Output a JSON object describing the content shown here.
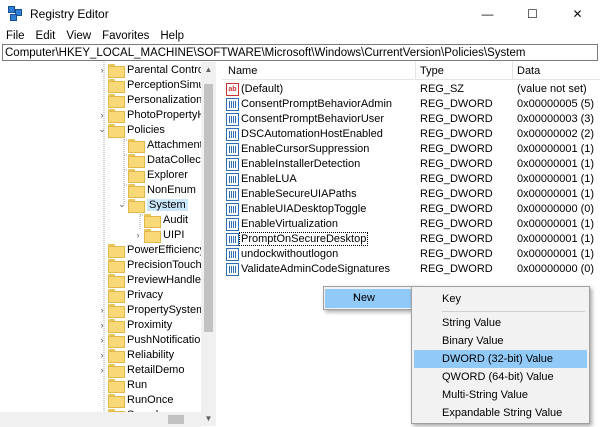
{
  "window": {
    "title": "Registry Editor",
    "minimize": "—",
    "maximize": "☐",
    "close": "✕"
  },
  "menu": [
    "File",
    "Edit",
    "View",
    "Favorites",
    "Help"
  ],
  "address": "Computer\\HKEY_LOCAL_MACHINE\\SOFTWARE\\Microsoft\\Windows\\CurrentVersion\\Policies\\System",
  "tree": [
    {
      "label": "Parental Control",
      "level": 0,
      "arrow": "›"
    },
    {
      "label": "PerceptionSimu",
      "level": 0,
      "arrow": ""
    },
    {
      "label": "Personalization",
      "level": 0,
      "arrow": ""
    },
    {
      "label": "PhotoPropertyH",
      "level": 0,
      "arrow": "›"
    },
    {
      "label": "Policies",
      "level": 0,
      "arrow": "⌄"
    },
    {
      "label": "Attachments",
      "level": 1,
      "arrow": ""
    },
    {
      "label": "DataCollectio",
      "level": 1,
      "arrow": ""
    },
    {
      "label": "Explorer",
      "level": 1,
      "arrow": ""
    },
    {
      "label": "NonEnum",
      "level": 1,
      "arrow": ""
    },
    {
      "label": "System",
      "level": 1,
      "arrow": "⌄",
      "selected": true
    },
    {
      "label": "Audit",
      "level": 2,
      "arrow": ""
    },
    {
      "label": "UIPI",
      "level": 2,
      "arrow": "›"
    },
    {
      "label": "PowerEfficiency",
      "level": 0,
      "arrow": ""
    },
    {
      "label": "PrecisionTouchP",
      "level": 0,
      "arrow": ""
    },
    {
      "label": "PreviewHandlers",
      "level": 0,
      "arrow": ""
    },
    {
      "label": "Privacy",
      "level": 0,
      "arrow": ""
    },
    {
      "label": "PropertySystem",
      "level": 0,
      "arrow": "›"
    },
    {
      "label": "Proximity",
      "level": 0,
      "arrow": "›"
    },
    {
      "label": "PushNotification",
      "level": 0,
      "arrow": "›"
    },
    {
      "label": "Reliability",
      "level": 0,
      "arrow": "›"
    },
    {
      "label": "RetailDemo",
      "level": 0,
      "arrow": "›"
    },
    {
      "label": "Run",
      "level": 0,
      "arrow": ""
    },
    {
      "label": "RunOnce",
      "level": 0,
      "arrow": ""
    },
    {
      "label": "Search",
      "level": 0,
      "arrow": "›"
    }
  ],
  "columns": {
    "name": "Name",
    "type": "Type",
    "data": "Data"
  },
  "values": [
    {
      "name": "(Default)",
      "type": "REG_SZ",
      "data": "(value not set)",
      "icon": "ab"
    },
    {
      "name": "ConsentPromptBehaviorAdmin",
      "type": "REG_DWORD",
      "data": "0x00000005 (5)",
      "icon": "dword"
    },
    {
      "name": "ConsentPromptBehaviorUser",
      "type": "REG_DWORD",
      "data": "0x00000003 (3)",
      "icon": "dword"
    },
    {
      "name": "DSCAutomationHostEnabled",
      "type": "REG_DWORD",
      "data": "0x00000002 (2)",
      "icon": "dword"
    },
    {
      "name": "EnableCursorSuppression",
      "type": "REG_DWORD",
      "data": "0x00000001 (1)",
      "icon": "dword"
    },
    {
      "name": "EnableInstallerDetection",
      "type": "REG_DWORD",
      "data": "0x00000001 (1)",
      "icon": "dword"
    },
    {
      "name": "EnableLUA",
      "type": "REG_DWORD",
      "data": "0x00000001 (1)",
      "icon": "dword"
    },
    {
      "name": "EnableSecureUIAPaths",
      "type": "REG_DWORD",
      "data": "0x00000001 (1)",
      "icon": "dword"
    },
    {
      "name": "EnableUIADesktopToggle",
      "type": "REG_DWORD",
      "data": "0x00000000 (0)",
      "icon": "dword"
    },
    {
      "name": "EnableVirtualization",
      "type": "REG_DWORD",
      "data": "0x00000001 (1)",
      "icon": "dword"
    },
    {
      "name": "PromptOnSecureDesktop",
      "type": "REG_DWORD",
      "data": "0x00000001 (1)",
      "icon": "dword",
      "focused": true
    },
    {
      "name": "undockwithoutlogon",
      "type": "REG_DWORD",
      "data": "0x00000001 (1)",
      "icon": "dword"
    },
    {
      "name": "ValidateAdminCodeSignatures",
      "type": "REG_DWORD",
      "data": "0x00000000 (0)",
      "icon": "dword"
    }
  ],
  "context_menu": {
    "new_label": "New",
    "submenu": {
      "key": "Key",
      "string": "String Value",
      "binary": "Binary Value",
      "dword": "DWORD (32-bit) Value",
      "qword": "QWORD (64-bit) Value",
      "multi": "Multi-String Value",
      "expandable": "Expandable String Value"
    }
  }
}
